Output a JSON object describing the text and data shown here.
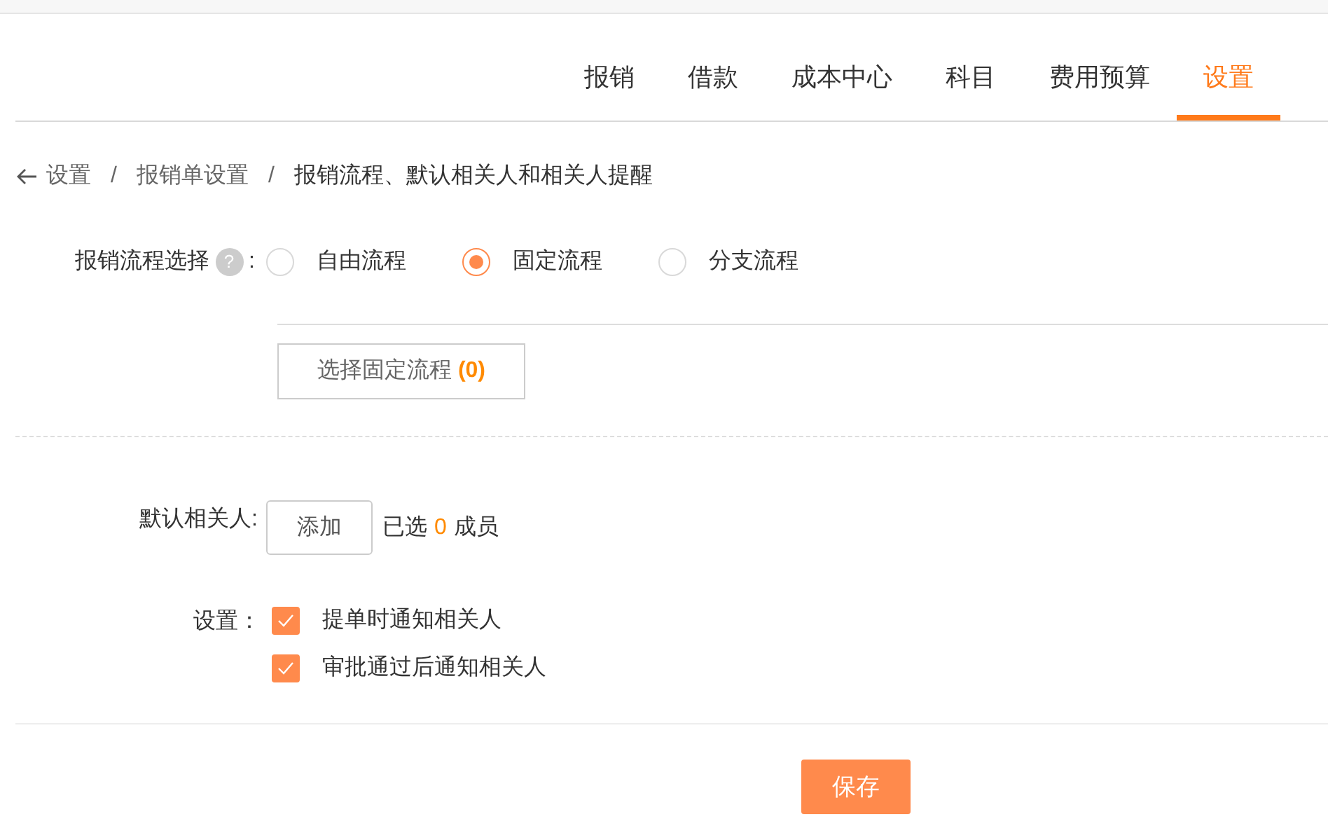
{
  "tabs": [
    {
      "label": "报销",
      "selected": false
    },
    {
      "label": "借款",
      "selected": false
    },
    {
      "label": "成本中心",
      "selected": false
    },
    {
      "label": "科目",
      "selected": false
    },
    {
      "label": "费用预算",
      "selected": false
    },
    {
      "label": "设置",
      "selected": true
    }
  ],
  "breadcrumb": [
    "设置",
    "报销单设置",
    "报销流程、默认相关人和相关人提醒"
  ],
  "breadcrumb_separator": "/",
  "flow": {
    "label": "报销流程选择",
    "help": "?",
    "colon": ":",
    "options": [
      {
        "label": "自由流程",
        "selected": false
      },
      {
        "label": "固定流程",
        "selected": true
      },
      {
        "label": "分支流程",
        "selected": false
      }
    ],
    "button": {
      "label": "选择固定流程",
      "count": "(0)"
    }
  },
  "contacts": {
    "label": "默认相关人:",
    "button": "添加",
    "prefix": "已选",
    "count": "0",
    "suffix": "成员"
  },
  "settings": {
    "label": "设置：",
    "options": [
      {
        "label": "提单时通知相关人",
        "checked": true
      },
      {
        "label": "审批通过后通知相关人",
        "checked": true
      }
    ]
  },
  "save": "保存"
}
